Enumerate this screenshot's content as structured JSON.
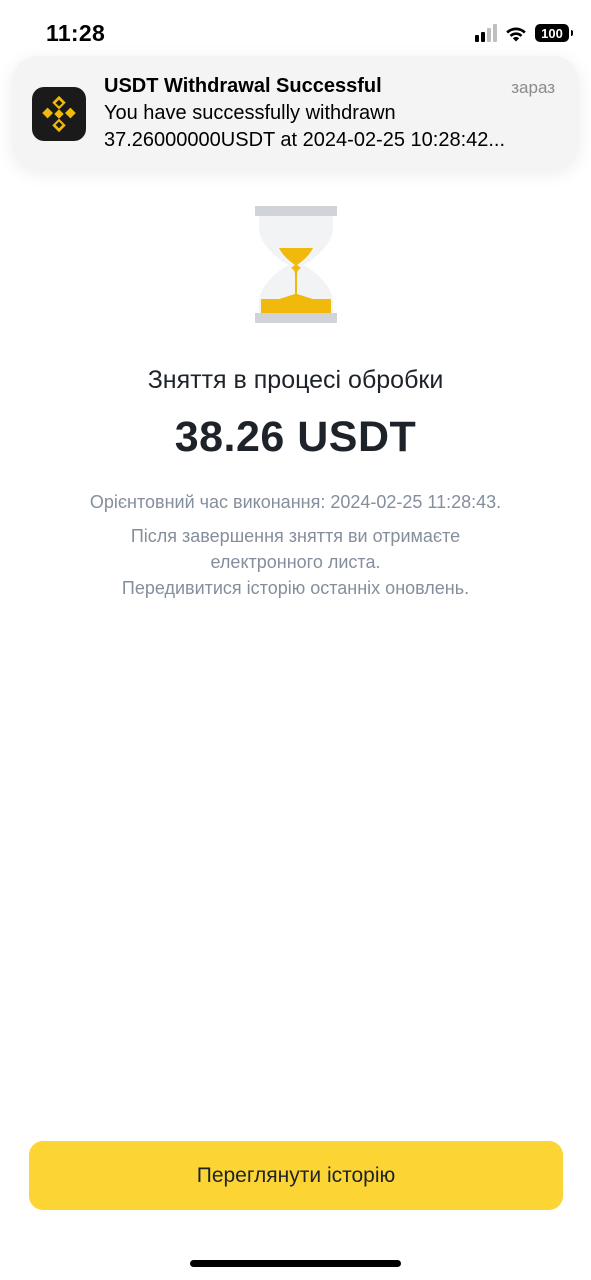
{
  "status_bar": {
    "time": "11:28",
    "battery": "100",
    "icons": [
      "signal-icon",
      "wifi-icon",
      "battery-icon"
    ]
  },
  "notification": {
    "app_icon": "binance-logo-icon",
    "title": "USDT Withdrawal Successful",
    "time": "зараз",
    "body_line1": "You have successfully withdrawn",
    "body_line2": "37.26000000USDT at 2024-02-25 10:28:42..."
  },
  "main": {
    "icon": "hourglass-icon",
    "headline": "Зняття в процесі обробки",
    "amount": "38.26 USDT",
    "eta": "Орієнтовний час виконання: 2024-02-25 11:28:43.",
    "email_line1": "Після завершення зняття ви отримаєте",
    "email_line2": "електронного листа.",
    "history_text": "Передивитися історію останніх оновлень."
  },
  "footer": {
    "button_label": "Переглянути історію"
  },
  "colors": {
    "accent": "#fcd535",
    "hourglass_sand": "#f0b90b",
    "text_primary": "#1e2329",
    "text_secondary": "#848e9c"
  }
}
